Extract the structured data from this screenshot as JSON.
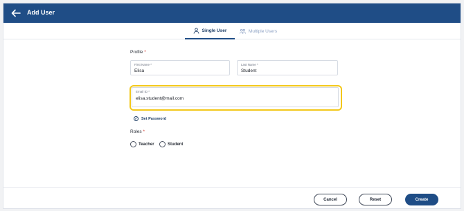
{
  "header": {
    "title": "Add User"
  },
  "tabs": [
    {
      "label": "Single User"
    },
    {
      "label": "Multiple Users"
    }
  ],
  "profile": {
    "label": "Profile",
    "required_mark": "*",
    "first_name": {
      "label": "First Name *",
      "value": "Elisa"
    },
    "last_name": {
      "label": "Last Name *",
      "value": "Student"
    },
    "email": {
      "label": "Email ID *",
      "value": "elisa.student@mail.com"
    }
  },
  "set_password": {
    "label": "Set Password"
  },
  "roles": {
    "label": "Roles",
    "required_mark": "*",
    "options": [
      {
        "label": "Teacher"
      },
      {
        "label": "Student"
      }
    ]
  },
  "footer": {
    "cancel_label": "Cancel",
    "reset_label": "Reset",
    "create_label": "Create"
  },
  "colors": {
    "header_bg": "#1f4d86",
    "highlight": "#f3c81a",
    "required": "#d0342c"
  }
}
